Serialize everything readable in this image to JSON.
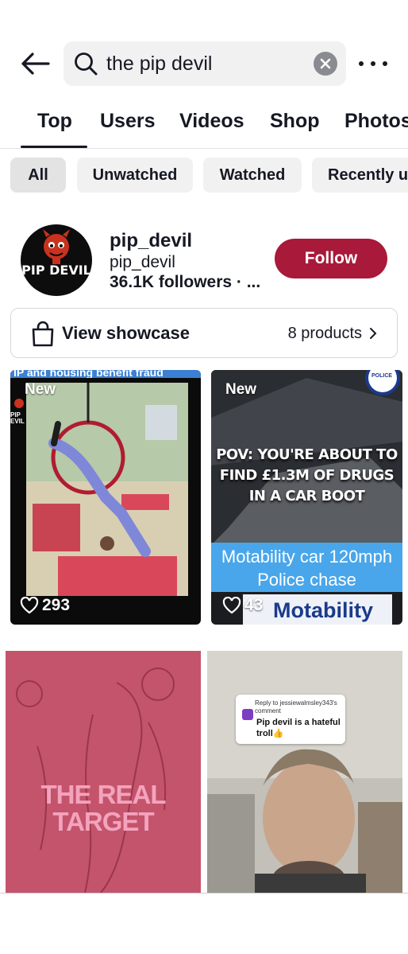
{
  "search": {
    "query": "the pip devil"
  },
  "tabs": [
    {
      "label": "Top",
      "active": true
    },
    {
      "label": "Users"
    },
    {
      "label": "Videos"
    },
    {
      "label": "Shop"
    },
    {
      "label": "Photos"
    }
  ],
  "filters": [
    {
      "label": "All",
      "active": true
    },
    {
      "label": "Unwatched"
    },
    {
      "label": "Watched"
    },
    {
      "label": "Recently uploaded"
    }
  ],
  "user": {
    "avatar_text": "PIP DEVIL",
    "name": "pip_devil",
    "handle": "pip_devil",
    "followers": "36.1K followers · ...",
    "follow_label": "Follow"
  },
  "showcase": {
    "label": "View showcase",
    "count": "8 products"
  },
  "videos": [
    {
      "badge": "New",
      "likes": "293",
      "top_text": "IP and housing benefit fraud",
      "logo_text": "PIP EVIL"
    },
    {
      "badge": "New",
      "likes": "43",
      "overlay": "POV: YOU'RE ABOUT TO FIND £1.3M OF DRUGS IN A CAR BOOT",
      "caption": "Motability car 120mph Police chase",
      "brand": "Motability",
      "police_text": "POLICE"
    },
    {
      "overlay": "THE REAL TARGET"
    },
    {
      "reply_to": "Reply to jessiewalmsley343's comment",
      "comment": "Pip devil is a hateful troll👍"
    }
  ],
  "colors": {
    "accent": "#a8193a",
    "chip_bg": "#f1f1f2",
    "chase_bg": "#49a6ea",
    "target_bg": "#c8566a"
  },
  "icons": [
    "back-arrow-icon",
    "search-icon",
    "clear-icon",
    "more-icon",
    "shopping-bag-icon",
    "chevron-right-icon",
    "heart-icon"
  ]
}
